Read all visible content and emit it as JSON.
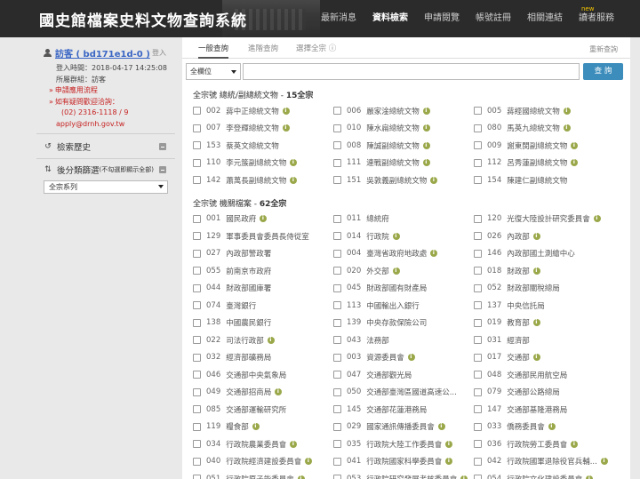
{
  "site_title": "國史館檔案史料文物查詢系統",
  "nav": [
    {
      "label": "最新消息",
      "active": false,
      "badge": ""
    },
    {
      "label": "資料檢索",
      "active": true,
      "badge": ""
    },
    {
      "label": "申請閱覽",
      "active": false,
      "badge": ""
    },
    {
      "label": "帳號註冊",
      "active": false,
      "badge": ""
    },
    {
      "label": "相關連結",
      "active": false,
      "badge": ""
    },
    {
      "label": "讀者服務",
      "active": false,
      "badge": "new"
    }
  ],
  "sidebar": {
    "user_link": "訪客 ( bd171e1d-0 )",
    "logout": "登入",
    "login_time": "登入時間：2018-04-17 14:25:08",
    "group": "所屬群組：訪客",
    "apply_flow": "申請應用流程",
    "contact_title": "如有疑問歡迎洽詢：",
    "phone": "(02) 2316-1118 / 9",
    "email": "apply@drnh.gov.tw",
    "history": "檢索歷史",
    "filter": "後分類篩選",
    "filter_note": "(不勾選即顯示全部)",
    "filter_value": "全宗系列"
  },
  "tabs": [
    "一般查詢",
    "進階查詢",
    "選擇全宗 ⓘ"
  ],
  "reset": "重新查詢",
  "search": {
    "field": "全欄位",
    "button": "查 詢",
    "placeholder": ""
  },
  "groups": [
    {
      "label": "全宗號 總統/副總統文物 - ",
      "count": "15全宗",
      "items": [
        {
          "code": "002",
          "name": "蔣中正總統文物",
          "info": true
        },
        {
          "code": "006",
          "name": "嚴家淦總統文物",
          "info": true
        },
        {
          "code": "005",
          "name": "蔣經國總統文物",
          "info": true
        },
        {
          "code": "007",
          "name": "李登輝總統文物",
          "info": true
        },
        {
          "code": "010",
          "name": "陳水扁總統文物",
          "info": true
        },
        {
          "code": "080",
          "name": "馬英九總統文物",
          "info": true
        },
        {
          "code": "153",
          "name": "蔡英文總統文物",
          "info": false
        },
        {
          "code": "008",
          "name": "陳誠副總統文物",
          "info": true
        },
        {
          "code": "009",
          "name": "謝東閔副總統文物",
          "info": true
        },
        {
          "code": "110",
          "name": "李元簇副總統文物",
          "info": true
        },
        {
          "code": "111",
          "name": "連戰副總統文物",
          "info": true
        },
        {
          "code": "112",
          "name": "呂秀蓮副總統文物",
          "info": true
        },
        {
          "code": "142",
          "name": "蕭萬長副總統文物",
          "info": true
        },
        {
          "code": "151",
          "name": "吳敦義副總統文物",
          "info": true
        },
        {
          "code": "154",
          "name": "陳建仁副總統文物",
          "info": false
        }
      ]
    },
    {
      "label": "全宗號 機關檔案 - ",
      "count": "62全宗",
      "items": [
        {
          "code": "001",
          "name": "國民政府",
          "info": true
        },
        {
          "code": "011",
          "name": "總統府",
          "info": false
        },
        {
          "code": "120",
          "name": "光復大陸設計研究委員會",
          "info": true
        },
        {
          "code": "129",
          "name": "軍事委員會委員長侍從室",
          "info": false
        },
        {
          "code": "014",
          "name": "行政院",
          "info": true
        },
        {
          "code": "026",
          "name": "內政部",
          "info": true
        },
        {
          "code": "027",
          "name": "內政部警政署",
          "info": false
        },
        {
          "code": "004",
          "name": "臺灣省政府地政處",
          "info": true
        },
        {
          "code": "146",
          "name": "內政部國土測繪中心",
          "info": false
        },
        {
          "code": "055",
          "name": "前南京市政府",
          "info": false
        },
        {
          "code": "020",
          "name": "外交部",
          "info": true
        },
        {
          "code": "018",
          "name": "財政部",
          "info": true
        },
        {
          "code": "044",
          "name": "財政部國庫署",
          "info": false
        },
        {
          "code": "045",
          "name": "財政部國有財產局",
          "info": false
        },
        {
          "code": "052",
          "name": "財政部關稅總局",
          "info": false
        },
        {
          "code": "074",
          "name": "臺灣銀行",
          "info": false
        },
        {
          "code": "113",
          "name": "中國輸出入銀行",
          "info": false
        },
        {
          "code": "137",
          "name": "中央信託局",
          "info": false
        },
        {
          "code": "138",
          "name": "中國農民銀行",
          "info": false
        },
        {
          "code": "139",
          "name": "中央存款保險公司",
          "info": false
        },
        {
          "code": "019",
          "name": "教育部",
          "info": true
        },
        {
          "code": "022",
          "name": "司法行政部",
          "info": true
        },
        {
          "code": "043",
          "name": "法務部",
          "info": false
        },
        {
          "code": "031",
          "name": "經濟部",
          "info": false
        },
        {
          "code": "032",
          "name": "經濟部礦務局",
          "info": false
        },
        {
          "code": "003",
          "name": "資源委員會",
          "info": true
        },
        {
          "code": "017",
          "name": "交通部",
          "info": true
        },
        {
          "code": "046",
          "name": "交通部中央氣象局",
          "info": false
        },
        {
          "code": "047",
          "name": "交通部觀光局",
          "info": false
        },
        {
          "code": "048",
          "name": "交通部民用航空局",
          "info": false
        },
        {
          "code": "049",
          "name": "交通部招商局",
          "info": true
        },
        {
          "code": "050",
          "name": "交通部臺灣區國道高速公...",
          "info": false
        },
        {
          "code": "079",
          "name": "交通部公路總局",
          "info": false
        },
        {
          "code": "085",
          "name": "交通部運輸研究所",
          "info": false
        },
        {
          "code": "145",
          "name": "交通部花蓮港務局",
          "info": false
        },
        {
          "code": "147",
          "name": "交通部基隆港務局",
          "info": false
        },
        {
          "code": "119",
          "name": "糧食部",
          "info": true
        },
        {
          "code": "029",
          "name": "國家通訊傳播委員會",
          "info": true
        },
        {
          "code": "033",
          "name": "僑務委員會",
          "info": true
        },
        {
          "code": "034",
          "name": "行政院農業委員會",
          "info": true
        },
        {
          "code": "035",
          "name": "行政院大陸工作委員會",
          "info": true
        },
        {
          "code": "036",
          "name": "行政院勞工委員會",
          "info": true
        },
        {
          "code": "040",
          "name": "行政院經濟建設委員會",
          "info": true
        },
        {
          "code": "041",
          "name": "行政院國家科學委員會",
          "info": true
        },
        {
          "code": "042",
          "name": "行政院國軍退除役官兵輔...",
          "info": true
        },
        {
          "code": "051",
          "name": "行政院原子能委員會",
          "info": true
        },
        {
          "code": "053",
          "name": "行政院研究發展考核委員會",
          "info": true
        },
        {
          "code": "054",
          "name": "行政院文化建設委員會",
          "info": true
        }
      ]
    }
  ]
}
